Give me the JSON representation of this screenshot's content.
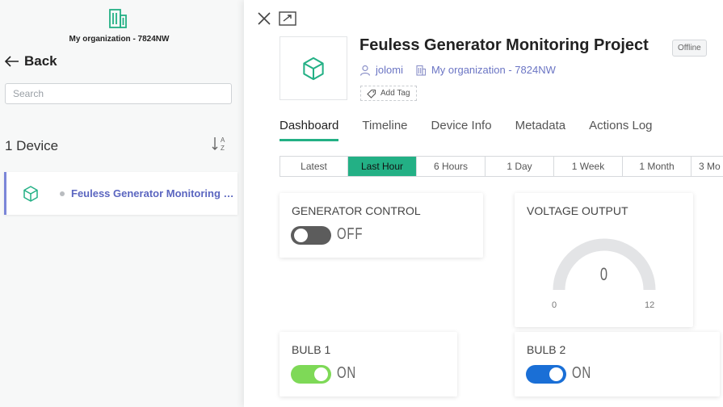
{
  "colors": {
    "accent": "#23b085",
    "link": "#6b75c4",
    "switch_on_green": "#7ed957",
    "switch_on_blue": "#1a6fd6",
    "switch_off": "#5c5c5c"
  },
  "sidebar": {
    "org_icon": "building-icon",
    "org_name": "My organization - 7824NW",
    "back_label": "Back",
    "search_placeholder": "Search",
    "device_count": "1 Device",
    "devices": [
      {
        "name": "Feuless Generator Monitoring Project",
        "status_dot": "offline"
      }
    ]
  },
  "header": {
    "title": "Feuless Generator Monitoring Project",
    "status": "Offline",
    "owner": "jolomi",
    "organization": "My organization - 7824NW",
    "add_tag_label": "Add Tag"
  },
  "tabs": [
    {
      "label": "Dashboard",
      "active": true
    },
    {
      "label": "Timeline",
      "active": false
    },
    {
      "label": "Device Info",
      "active": false
    },
    {
      "label": "Metadata",
      "active": false
    },
    {
      "label": "Actions Log",
      "active": false
    }
  ],
  "time_ranges": [
    {
      "label": "Latest",
      "active": false
    },
    {
      "label": "Last Hour",
      "active": true
    },
    {
      "label": "6 Hours",
      "active": false
    },
    {
      "label": "1 Day",
      "active": false
    },
    {
      "label": "1 Week",
      "active": false
    },
    {
      "label": "1 Month",
      "active": false
    },
    {
      "label": "3 Mo",
      "active": false
    }
  ],
  "widgets": {
    "generator_control": {
      "title": "GENERATOR CONTROL",
      "state": "OFF"
    },
    "voltage_output": {
      "title": "VOLTAGE OUTPUT",
      "value": "0",
      "min": "0",
      "max": "12"
    },
    "bulb1": {
      "title": "BULB 1",
      "state": "ON"
    },
    "bulb2": {
      "title": "BULB 2",
      "state": "ON"
    }
  }
}
